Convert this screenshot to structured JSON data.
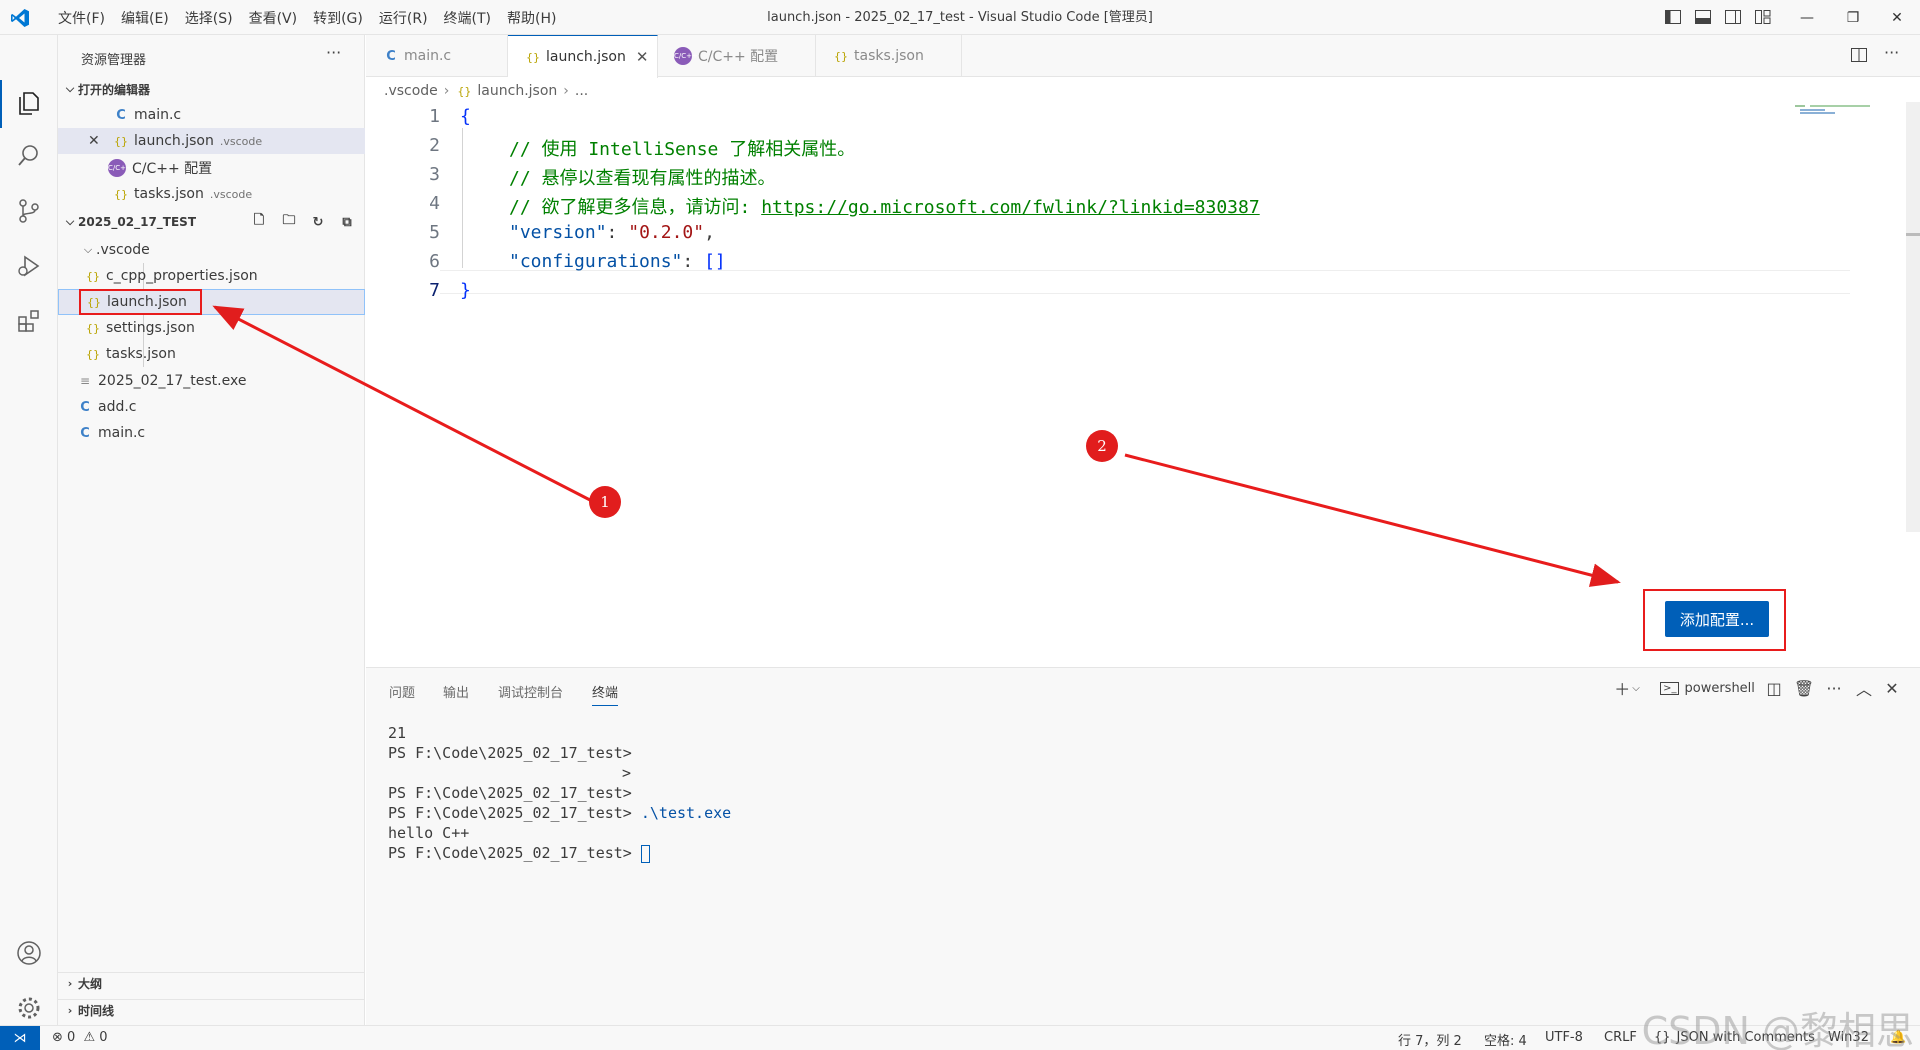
{
  "window": {
    "title": "launch.json - 2025_02_17_test - Visual Studio Code [管理员]"
  },
  "menu": [
    "文件(F)",
    "编辑(E)",
    "选择(S)",
    "查看(V)",
    "转到(G)",
    "运行(R)",
    "终端(T)",
    "帮助(H)"
  ],
  "sidebar": {
    "title": "资源管理器",
    "open_editors_header": "打开的编辑器",
    "open_editors": [
      {
        "icon": "C",
        "name": "main.c",
        "desc": ""
      },
      {
        "icon": "{}",
        "name": "launch.json",
        "desc": ".vscode"
      },
      {
        "icon": "gear",
        "name": "C/C++ 配置",
        "desc": ""
      },
      {
        "icon": "{}",
        "name": "tasks.json",
        "desc": ".vscode"
      }
    ],
    "folder_header": "2025_02_17_TEST",
    "tree": {
      "vscode_folder": ".vscode",
      "vscode_files": [
        "c_cpp_properties.json",
        "launch.json",
        "settings.json",
        "tasks.json"
      ],
      "root_files": [
        {
          "icon": "exe",
          "name": "2025_02_17_test.exe"
        },
        {
          "icon": "C",
          "name": "add.c"
        },
        {
          "icon": "C",
          "name": "main.c"
        }
      ]
    },
    "outline_header": "大纲",
    "timeline_header": "时间线"
  },
  "tabs": [
    {
      "icon": "C",
      "label": "main.c"
    },
    {
      "icon": "{}",
      "label": "launch.json",
      "active": true
    },
    {
      "icon": "gear",
      "label": "C/C++ 配置"
    },
    {
      "icon": "{}",
      "label": "tasks.json"
    }
  ],
  "breadcrumb": {
    "folder": ".vscode",
    "file": "launch.json",
    "more": "..."
  },
  "editor": {
    "line_numbers": [
      "1",
      "2",
      "3",
      "4",
      "5",
      "6",
      "7"
    ],
    "line1": "{",
    "line2_comment": "// 使用 IntelliSense 了解相关属性。",
    "line3_comment": "// 悬停以查看现有属性的描述。",
    "line4_comment": "// 欲了解更多信息，请访问: ",
    "line4_link": "https://go.microsoft.com/fwlink/?linkid=830387",
    "line5_key": "\"version\"",
    "line5_value": "\"0.2.0\"",
    "line6_key": "\"configurations\"",
    "line6_value": "[]",
    "line7": "}",
    "add_config_button": "添加配置..."
  },
  "panel": {
    "tabs": [
      "问题",
      "输出",
      "调试控制台",
      "终端"
    ],
    "active_tab": "终端",
    "shell_label": "powershell",
    "terminal": {
      "line1": "21",
      "line2": "PS F:\\Code\\2025_02_17_test>",
      "line3": ">",
      "line4": "PS F:\\Code\\2025_02_17_test>",
      "line5_prompt": "PS F:\\Code\\2025_02_17_test>",
      "line5_cmd": ".\\test.exe",
      "line6": "hello C++",
      "line7_prompt": "PS F:\\Code\\2025_02_17_test>"
    }
  },
  "statusbar": {
    "errors": "0",
    "warnings": "0",
    "position": "行 7，列 2",
    "spaces": "空格: 4",
    "encoding": "UTF-8",
    "eol": "CRLF",
    "language": "JSON with Comments",
    "platform": "Win32"
  },
  "annotations": {
    "badge1": "1",
    "badge2": "2",
    "watermark": "CSDN @黎相思"
  },
  "colors": {
    "accent": "#005fb8",
    "annotation": "#e11d1d"
  }
}
